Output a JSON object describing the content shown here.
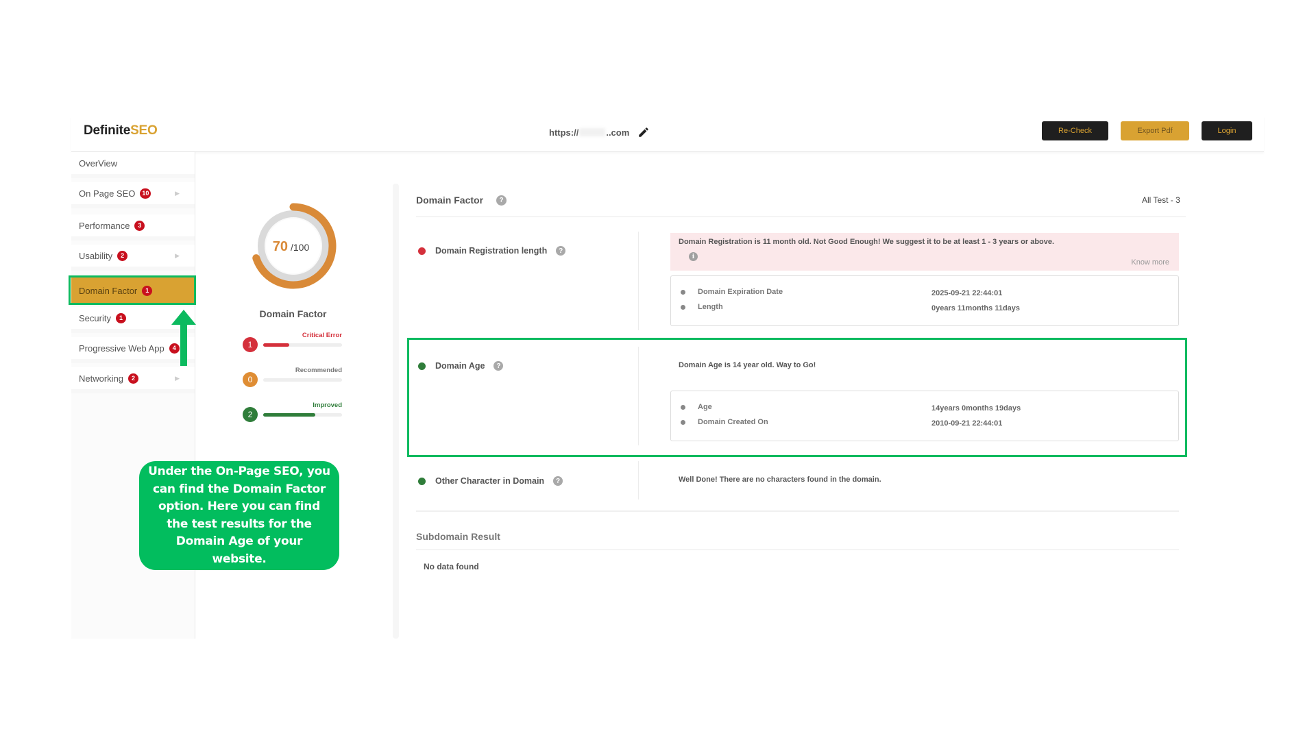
{
  "header": {
    "logo_main": "Definite",
    "logo_accent": "SEO",
    "url_prefix": "https://",
    "url_suffix": "..com",
    "buttons": {
      "recheck": "Re-Check",
      "export": "Export Pdf",
      "login": "Login"
    }
  },
  "sidebar": {
    "items": [
      {
        "label": "OverView",
        "badge": null,
        "chevron": false
      },
      {
        "label": "On Page SEO",
        "badge": "10",
        "chevron": true
      },
      {
        "label": "Performance",
        "badge": "3",
        "chevron": false
      },
      {
        "label": "Usability",
        "badge": "2",
        "chevron": true
      },
      {
        "label": "Domain Factor",
        "badge": "1",
        "chevron": false,
        "active": true
      },
      {
        "label": "Security",
        "badge": "1",
        "chevron": false
      },
      {
        "label": "Progressive Web App",
        "badge": "4",
        "chevron": false
      },
      {
        "label": "Networking",
        "badge": "2",
        "chevron": true
      }
    ]
  },
  "score": {
    "value": "70",
    "max": "/100",
    "fraction": 0.7,
    "title": "Domain Factor",
    "stats": [
      {
        "count": "1",
        "label": "Critical Error",
        "color": "#d4303b",
        "fill": 0.33
      },
      {
        "count": "0",
        "label": "Recommended",
        "color": "#df8d34",
        "fill": 0
      },
      {
        "count": "2",
        "label": "Improved",
        "color": "#2f7d3a",
        "fill": 0.66
      }
    ]
  },
  "panel": {
    "title": "Domain Factor",
    "all_test": "All Test - 3",
    "tests": [
      {
        "name": "Domain Registration length",
        "status": "error",
        "alert_message": "Domain Registration is 11 month old. Not Good Enough! We suggest it to be at least 1 - 3 years or above.",
        "know_more": "Know more",
        "details": [
          {
            "label": "Domain Expiration Date",
            "value": "2025-09-21 22:44:01"
          },
          {
            "label": "Length",
            "value": "0years 11months 11days"
          }
        ]
      },
      {
        "name": "Domain Age",
        "status": "pass",
        "message": "Domain Age is 14 year old. Way to Go!",
        "details": [
          {
            "label": "Age",
            "value": "14years 0months 19days"
          },
          {
            "label": "Domain Created On",
            "value": "2010-09-21 22:44:01"
          }
        ]
      },
      {
        "name": "Other Character in Domain",
        "status": "pass",
        "message": "Well Done! There are no characters found in the domain."
      }
    ],
    "subdomain_title": "Subdomain Result",
    "subdomain_empty": "No data found"
  },
  "callout": {
    "text": "Under the On-Page SEO, you can find the Domain Factor option. Here you can find the test results for the Domain Age of your website."
  },
  "colors": {
    "accent": "#d9a232",
    "dark": "#1f1f1f",
    "error": "#d4303b",
    "pass": "#2f7d3a",
    "highlight": "#0cba5f"
  }
}
